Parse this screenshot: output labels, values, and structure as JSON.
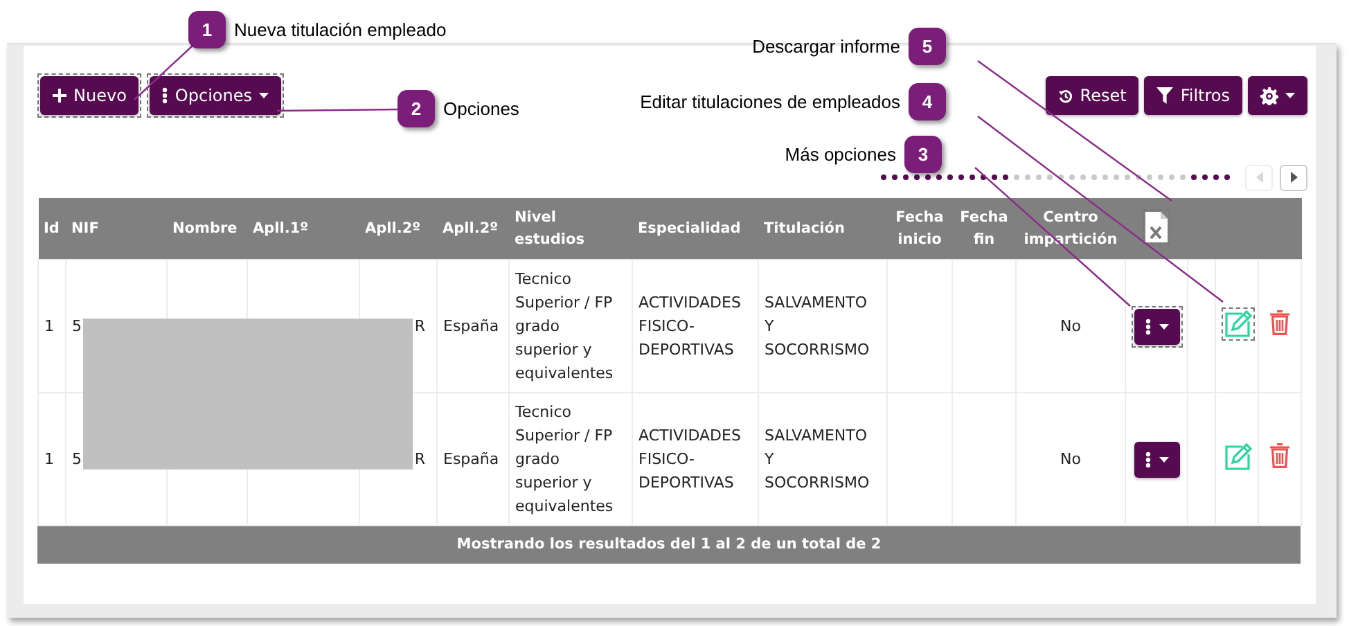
{
  "callouts": [
    {
      "number": "1",
      "label": "Nueva titulación empleado"
    },
    {
      "number": "5",
      "label": "Descargar informe"
    },
    {
      "number": "2",
      "label": "Opciones"
    },
    {
      "number": "4",
      "label": "Editar titulaciones de empleados"
    },
    {
      "number": "3",
      "label": "Más opciones"
    }
  ],
  "toolbar_left": [
    {
      "kind": "new",
      "label": "Nuevo",
      "highlighted": true
    },
    {
      "kind": "options",
      "label": "Opciones",
      "highlighted": true
    }
  ],
  "toolbar_right": [
    {
      "kind": "reset",
      "label": "Reset"
    },
    {
      "kind": "filter",
      "label": "Filtros"
    },
    {
      "kind": "settings"
    }
  ],
  "pager": [
    {
      "kind": "prev",
      "disabled": true
    },
    {
      "kind": "next",
      "disabled": false
    }
  ],
  "table": {
    "columns": [
      "Id",
      "NIF",
      "Nombre",
      "Apll.1º",
      "Apll.2º",
      "Apll.2º",
      "Nivel estudios",
      "Especialidad",
      "Titulación",
      "Fecha inicio",
      "Fecha fin",
      "Centro impartición"
    ],
    "export_highlighted": true,
    "rows": [
      {
        "cells": [
          "1",
          "5",
          null,
          null,
          "R",
          "España",
          "Tecnico Superior / FP grado superior y equivalentes",
          "ACTIVIDADES FISICO-DEPORTIVAS",
          "SALVAMENTO Y SOCORRISMO",
          null,
          null,
          "No"
        ],
        "redacted": true,
        "more_highlighted": true,
        "edit_highlighted": true
      },
      {
        "cells": [
          "1",
          "5",
          null,
          null,
          "R",
          "España",
          "Tecnico Superior / FP grado superior y equivalentes",
          "ACTIVIDADES FISICO-DEPORTIVAS",
          "SALVAMENTO Y SOCORRISMO",
          null,
          null,
          "No"
        ],
        "redacted": true,
        "more_highlighted": false,
        "edit_highlighted": false
      }
    ],
    "footer": "Mostrando los resultados del 1 al 2 de un total de 2"
  }
}
